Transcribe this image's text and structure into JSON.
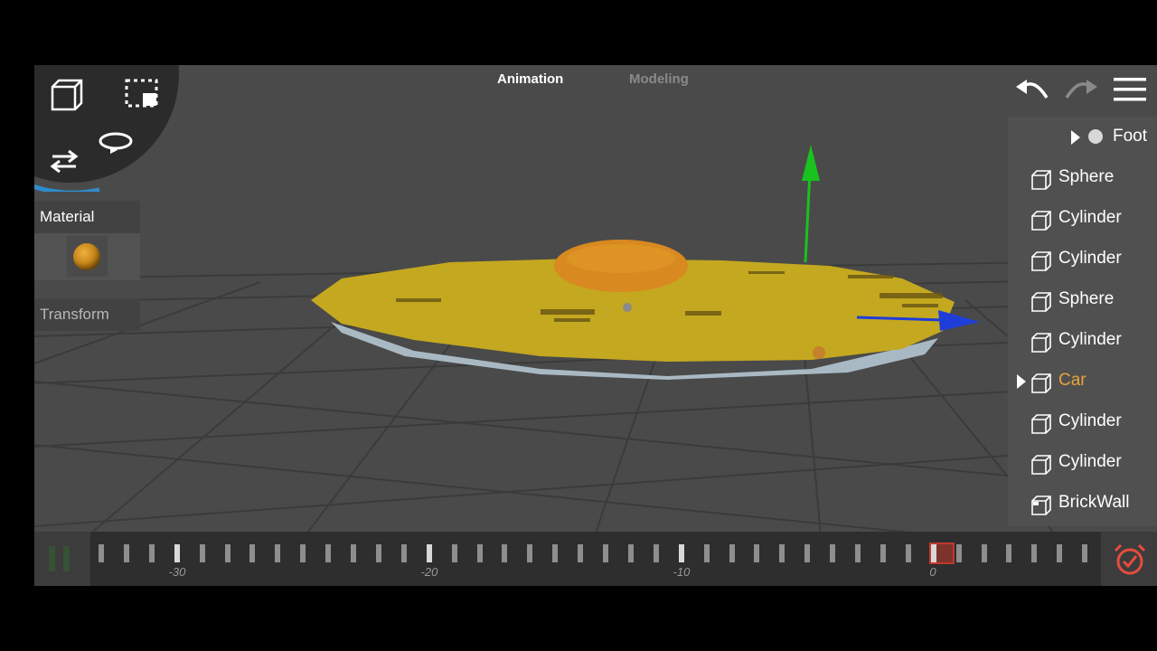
{
  "header": {
    "tabs": [
      {
        "label": "Animation",
        "active": true
      },
      {
        "label": "Modeling",
        "active": false
      }
    ]
  },
  "toolbar": {
    "icons": [
      "cube-icon",
      "box-select-icon",
      "move-icon",
      "rotate-icon",
      "undo-icon",
      "redo-icon",
      "menu-icon"
    ]
  },
  "left_panel": {
    "material_label": "Material",
    "transform_label": "Transform",
    "material_color": "#c7861a"
  },
  "outliner": {
    "items": [
      {
        "label": "Foot",
        "icon": "sphere-node-icon",
        "expandable": true,
        "selected": false
      },
      {
        "label": "Sphere",
        "icon": "mesh-icon",
        "expandable": false,
        "selected": false
      },
      {
        "label": "Cylinder",
        "icon": "mesh-icon",
        "expandable": false,
        "selected": false
      },
      {
        "label": "Cylinder",
        "icon": "mesh-icon",
        "expandable": false,
        "selected": false
      },
      {
        "label": "Sphere",
        "icon": "mesh-icon",
        "expandable": false,
        "selected": false
      },
      {
        "label": "Cylinder",
        "icon": "mesh-icon",
        "expandable": false,
        "selected": false
      },
      {
        "label": "Car",
        "icon": "mesh-icon",
        "expandable": true,
        "selected": true
      },
      {
        "label": "Cylinder",
        "icon": "mesh-icon",
        "expandable": false,
        "selected": false
      },
      {
        "label": "Cylinder",
        "icon": "mesh-icon",
        "expandable": false,
        "selected": false
      },
      {
        "label": "BrickWall",
        "icon": "textured-mesh-icon",
        "expandable": false,
        "selected": false
      }
    ],
    "selected_color": "#e8a33a"
  },
  "timeline": {
    "labels": [
      "-30",
      "-20",
      "-10",
      "0"
    ],
    "current_frame": "0",
    "playhead_color": "#c0392b"
  },
  "colors": {
    "plate_top": "#c4a81f",
    "plate_rim": "#a9b9c4",
    "dome": "#d8891f",
    "gizmo_y": "#19c21f",
    "gizmo_z": "#1f3ed9",
    "grid_line": "#3a3a3a"
  }
}
